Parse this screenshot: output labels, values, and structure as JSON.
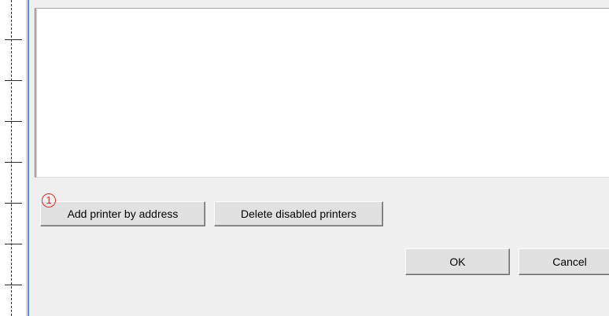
{
  "buttons": {
    "add_printer_label": "Add printer by address",
    "delete_disabled_label": "Delete disabled printers",
    "ok_label": "OK",
    "cancel_label": "Cancel"
  },
  "annotation": {
    "badge_number": "1",
    "color": "#e03030"
  },
  "colors": {
    "accent": "#5a8fd4",
    "background": "#f0f0f0"
  }
}
